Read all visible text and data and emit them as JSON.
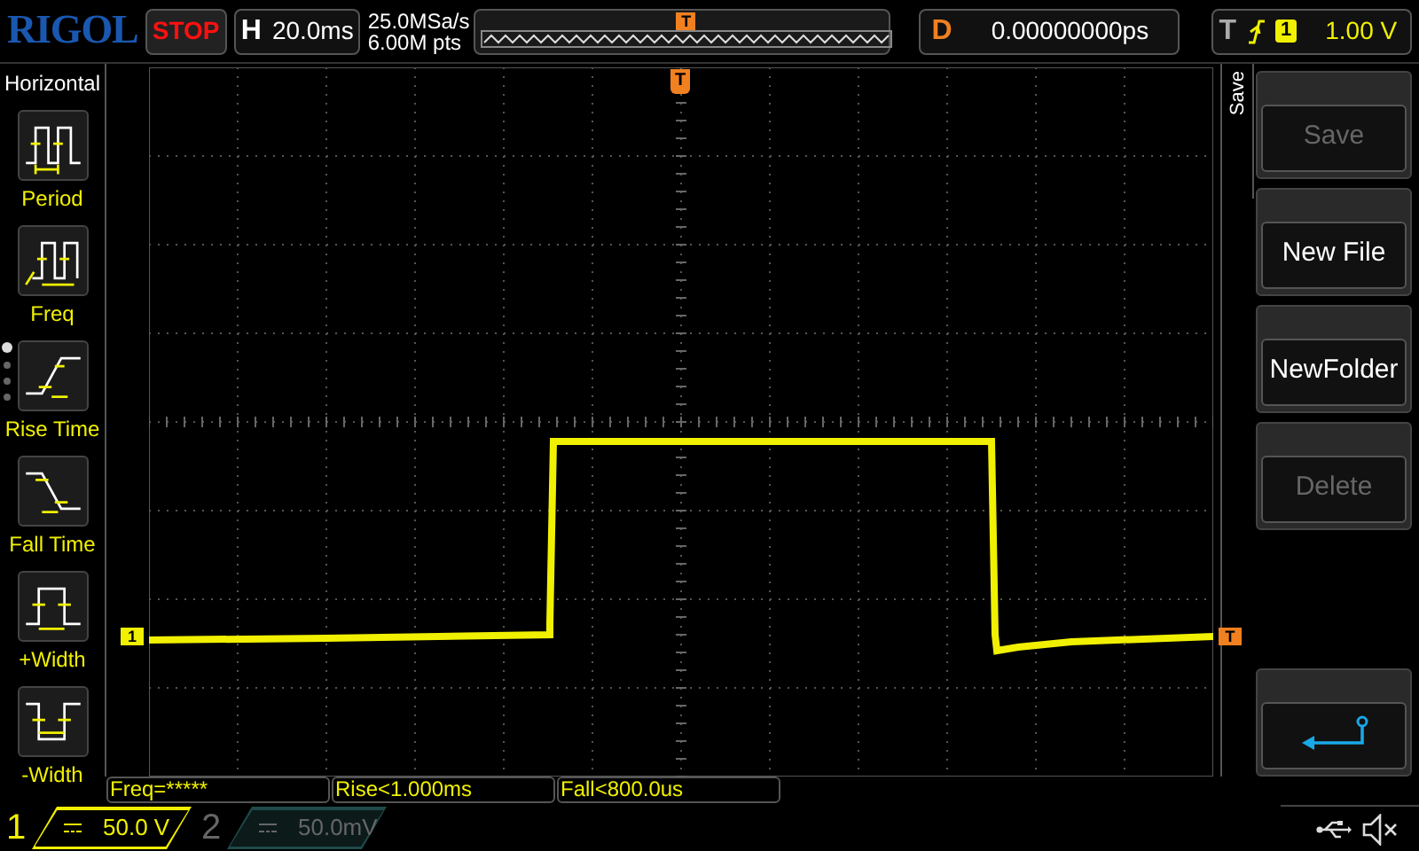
{
  "top_bar": {
    "logo": "RIGOL",
    "run_state": "STOP",
    "timebase": {
      "label": "H",
      "value": "20.0ms"
    },
    "sample_rate": "25.0MSa/s",
    "memory_depth": "6.00M pts",
    "memory_trigger_marker": "T",
    "delay": {
      "label": "D",
      "value": "0.00000000ps"
    },
    "trigger": {
      "label": "T",
      "source": "1",
      "level": "1.00 V"
    }
  },
  "left_menu": {
    "title": "Horizontal",
    "pages": [
      {
        "selected": true
      },
      {
        "selected": false
      },
      {
        "selected": false
      },
      {
        "selected": false
      }
    ],
    "items": [
      {
        "kind": "period",
        "label": "Period"
      },
      {
        "kind": "freq",
        "label": "Freq"
      },
      {
        "kind": "rise",
        "label": "Rise Time"
      },
      {
        "kind": "fall",
        "label": "Fall Time"
      },
      {
        "kind": "pwidth",
        "label": "+Width"
      },
      {
        "kind": "nwidth",
        "label": "-Width"
      }
    ]
  },
  "screen": {
    "trigger_top_marker": "T",
    "channel_marker": "1",
    "trigger_level_marker": "T"
  },
  "right_menu": {
    "tab": "Save",
    "buttons": [
      {
        "label": "Save",
        "disabled": true
      },
      {
        "label": "New File",
        "disabled": false
      },
      {
        "label": "NewFolder",
        "disabled": false
      },
      {
        "label": "Delete",
        "disabled": true
      }
    ]
  },
  "measurements": [
    "Freq=*****",
    "Rise<1.000ms",
    "Fall<800.0us"
  ],
  "channels": [
    {
      "label": "1",
      "scale": "50.0 V",
      "selected": true
    },
    {
      "label": "2",
      "scale": "50.0mV",
      "selected": false
    }
  ]
}
